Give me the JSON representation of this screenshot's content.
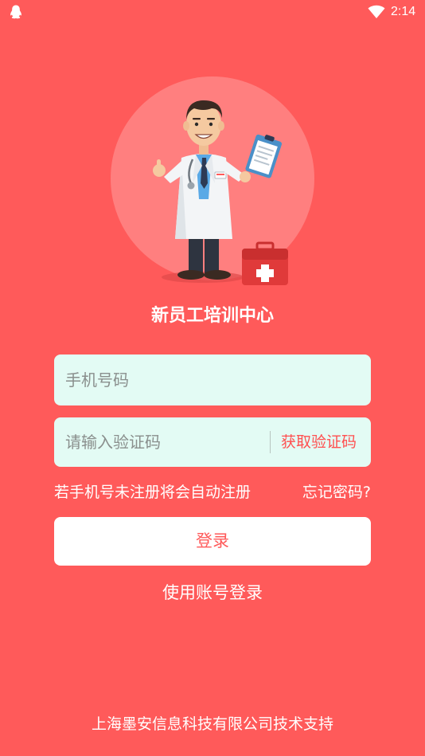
{
  "status_bar": {
    "time": "2:14",
    "app_icon": "qq-penguin-icon",
    "wifi_icon": "wifi-icon"
  },
  "app_title": "新员工培训中心",
  "phone_field": {
    "placeholder": "手机号码",
    "value": ""
  },
  "code_field": {
    "placeholder": "请输入验证码",
    "value": "",
    "get_code_label": "获取验证码"
  },
  "hint": {
    "auto_register": "若手机号未注册将会自动注册",
    "forgot_password": "忘记密码?"
  },
  "login_button": "登录",
  "account_login": "使用账号登录",
  "footer": "上海墨安信息科技有限公司技术支持",
  "colors": {
    "background": "#ff5a5a",
    "input_background": "#e3fbf4",
    "accent": "#ff4f4f",
    "white": "#ffffff"
  }
}
